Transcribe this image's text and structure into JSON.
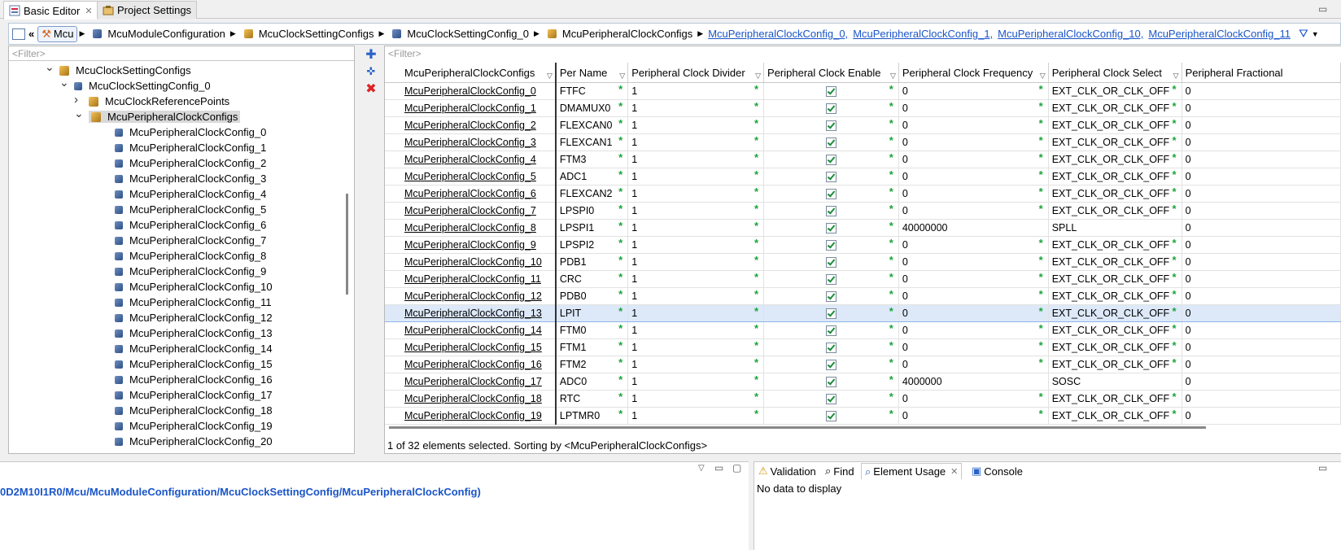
{
  "tabs": [
    {
      "label": "Basic Editor",
      "active": true
    },
    {
      "label": "Project Settings",
      "active": false
    }
  ],
  "breadcrumb": {
    "root": "Mcu",
    "items": [
      "McuModuleConfiguration",
      "McuClockSettingConfigs",
      "McuClockSettingConfig_0",
      "McuPeripheralClockConfigs"
    ],
    "links": [
      "McuPeripheralClockConfig_0,",
      "McuPeripheralClockConfig_1,",
      "McuPeripheralClockConfig_10,",
      "McuPeripheralClockConfig_11"
    ]
  },
  "tree": {
    "filter_placeholder": "<Filter>",
    "nodes": [
      {
        "label": "McuClockSettingConfigs",
        "level": 0,
        "expander": "open",
        "icon": "gold"
      },
      {
        "label": "McuClockSettingConfig_0",
        "level": 1,
        "expander": "open",
        "icon": "blue"
      },
      {
        "label": "McuClockReferencePoints",
        "level": 2,
        "expander": "closed",
        "icon": "gold"
      },
      {
        "label": "McuPeripheralClockConfigs",
        "level": 2,
        "expander": "open",
        "icon": "gold",
        "selected": true
      },
      {
        "label": "McuPeripheralClockConfig_0",
        "level": 3,
        "icon": "blue"
      },
      {
        "label": "McuPeripheralClockConfig_1",
        "level": 3,
        "icon": "blue"
      },
      {
        "label": "McuPeripheralClockConfig_2",
        "level": 3,
        "icon": "blue"
      },
      {
        "label": "McuPeripheralClockConfig_3",
        "level": 3,
        "icon": "blue"
      },
      {
        "label": "McuPeripheralClockConfig_4",
        "level": 3,
        "icon": "blue"
      },
      {
        "label": "McuPeripheralClockConfig_5",
        "level": 3,
        "icon": "blue"
      },
      {
        "label": "McuPeripheralClockConfig_6",
        "level": 3,
        "icon": "blue"
      },
      {
        "label": "McuPeripheralClockConfig_7",
        "level": 3,
        "icon": "blue"
      },
      {
        "label": "McuPeripheralClockConfig_8",
        "level": 3,
        "icon": "blue"
      },
      {
        "label": "McuPeripheralClockConfig_9",
        "level": 3,
        "icon": "blue"
      },
      {
        "label": "McuPeripheralClockConfig_10",
        "level": 3,
        "icon": "blue"
      },
      {
        "label": "McuPeripheralClockConfig_11",
        "level": 3,
        "icon": "blue"
      },
      {
        "label": "McuPeripheralClockConfig_12",
        "level": 3,
        "icon": "blue"
      },
      {
        "label": "McuPeripheralClockConfig_13",
        "level": 3,
        "icon": "blue"
      },
      {
        "label": "McuPeripheralClockConfig_14",
        "level": 3,
        "icon": "blue"
      },
      {
        "label": "McuPeripheralClockConfig_15",
        "level": 3,
        "icon": "blue"
      },
      {
        "label": "McuPeripheralClockConfig_16",
        "level": 3,
        "icon": "blue"
      },
      {
        "label": "McuPeripheralClockConfig_17",
        "level": 3,
        "icon": "blue"
      },
      {
        "label": "McuPeripheralClockConfig_18",
        "level": 3,
        "icon": "blue"
      },
      {
        "label": "McuPeripheralClockConfig_19",
        "level": 3,
        "icon": "blue"
      },
      {
        "label": "McuPeripheralClockConfig_20",
        "level": 3,
        "icon": "blue"
      }
    ]
  },
  "table": {
    "filter_placeholder": "<Filter>",
    "columns": [
      "McuPeripheralClockConfigs",
      "Per Name",
      "Peripheral Clock Divider",
      "Peripheral Clock Enable",
      "Peripheral Clock Frequency",
      "Peripheral Clock Select",
      "Peripheral Fractional"
    ],
    "rows": [
      {
        "name": "McuPeripheralClockConfig_0",
        "per": "FTFC",
        "div": "1",
        "enable": true,
        "freq": "0",
        "sel": "EXT_CLK_OR_CLK_OFF",
        "frac": "0",
        "freq_star": true,
        "sel_star": true
      },
      {
        "name": "McuPeripheralClockConfig_1",
        "per": "DMAMUX0",
        "div": "1",
        "enable": true,
        "freq": "0",
        "sel": "EXT_CLK_OR_CLK_OFF",
        "frac": "0",
        "freq_star": true,
        "sel_star": true
      },
      {
        "name": "McuPeripheralClockConfig_2",
        "per": "FLEXCAN0",
        "div": "1",
        "enable": true,
        "freq": "0",
        "sel": "EXT_CLK_OR_CLK_OFF",
        "frac": "0",
        "freq_star": true,
        "sel_star": true
      },
      {
        "name": "McuPeripheralClockConfig_3",
        "per": "FLEXCAN1",
        "div": "1",
        "enable": true,
        "freq": "0",
        "sel": "EXT_CLK_OR_CLK_OFF",
        "frac": "0",
        "freq_star": true,
        "sel_star": true
      },
      {
        "name": "McuPeripheralClockConfig_4",
        "per": "FTM3",
        "div": "1",
        "enable": true,
        "freq": "0",
        "sel": "EXT_CLK_OR_CLK_OFF",
        "frac": "0",
        "freq_star": true,
        "sel_star": true
      },
      {
        "name": "McuPeripheralClockConfig_5",
        "per": "ADC1",
        "div": "1",
        "enable": true,
        "freq": "0",
        "sel": "EXT_CLK_OR_CLK_OFF",
        "frac": "0",
        "freq_star": true,
        "sel_star": true
      },
      {
        "name": "McuPeripheralClockConfig_6",
        "per": "FLEXCAN2",
        "div": "1",
        "enable": true,
        "freq": "0",
        "sel": "EXT_CLK_OR_CLK_OFF",
        "frac": "0",
        "freq_star": true,
        "sel_star": true
      },
      {
        "name": "McuPeripheralClockConfig_7",
        "per": "LPSPI0",
        "div": "1",
        "enable": true,
        "freq": "0",
        "sel": "EXT_CLK_OR_CLK_OFF",
        "frac": "0",
        "freq_star": true,
        "sel_star": true
      },
      {
        "name": "McuPeripheralClockConfig_8",
        "per": "LPSPI1",
        "div": "1",
        "enable": true,
        "freq": "40000000",
        "sel": "SPLL",
        "frac": "0",
        "freq_star": false,
        "sel_star": false
      },
      {
        "name": "McuPeripheralClockConfig_9",
        "per": "LPSPI2",
        "div": "1",
        "enable": true,
        "freq": "0",
        "sel": "EXT_CLK_OR_CLK_OFF",
        "frac": "0",
        "freq_star": true,
        "sel_star": true
      },
      {
        "name": "McuPeripheralClockConfig_10",
        "per": "PDB1",
        "div": "1",
        "enable": true,
        "freq": "0",
        "sel": "EXT_CLK_OR_CLK_OFF",
        "frac": "0",
        "freq_star": true,
        "sel_star": true
      },
      {
        "name": "McuPeripheralClockConfig_11",
        "per": "CRC",
        "div": "1",
        "enable": true,
        "freq": "0",
        "sel": "EXT_CLK_OR_CLK_OFF",
        "frac": "0",
        "freq_star": true,
        "sel_star": true
      },
      {
        "name": "McuPeripheralClockConfig_12",
        "per": "PDB0",
        "div": "1",
        "enable": true,
        "freq": "0",
        "sel": "EXT_CLK_OR_CLK_OFF",
        "frac": "0",
        "freq_star": true,
        "sel_star": true
      },
      {
        "name": "McuPeripheralClockConfig_13",
        "per": "LPIT",
        "div": "1",
        "enable": true,
        "freq": "0",
        "sel": "EXT_CLK_OR_CLK_OFF",
        "frac": "0",
        "freq_star": true,
        "sel_star": true,
        "highlight": true
      },
      {
        "name": "McuPeripheralClockConfig_14",
        "per": "FTM0",
        "div": "1",
        "enable": true,
        "freq": "0",
        "sel": "EXT_CLK_OR_CLK_OFF",
        "frac": "0",
        "freq_star": true,
        "sel_star": true
      },
      {
        "name": "McuPeripheralClockConfig_15",
        "per": "FTM1",
        "div": "1",
        "enable": true,
        "freq": "0",
        "sel": "EXT_CLK_OR_CLK_OFF",
        "frac": "0",
        "freq_star": true,
        "sel_star": true
      },
      {
        "name": "McuPeripheralClockConfig_16",
        "per": "FTM2",
        "div": "1",
        "enable": true,
        "freq": "0",
        "sel": "EXT_CLK_OR_CLK_OFF",
        "frac": "0",
        "freq_star": true,
        "sel_star": true
      },
      {
        "name": "McuPeripheralClockConfig_17",
        "per": "ADC0",
        "div": "1",
        "enable": true,
        "freq": "4000000",
        "sel": "SOSC",
        "frac": "0",
        "freq_star": false,
        "sel_star": false
      },
      {
        "name": "McuPeripheralClockConfig_18",
        "per": "RTC",
        "div": "1",
        "enable": true,
        "freq": "0",
        "sel": "EXT_CLK_OR_CLK_OFF",
        "frac": "0",
        "freq_star": true,
        "sel_star": true
      },
      {
        "name": "McuPeripheralClockConfig_19",
        "per": "LPTMR0",
        "div": "1",
        "enable": true,
        "freq": "0",
        "sel": "EXT_CLK_OR_CLK_OFF",
        "frac": "0",
        "freq_star": true,
        "sel_star": true
      }
    ]
  },
  "status": "1 of 32 elements selected. Sorting by <McuPeripheralClockConfigs>",
  "bottom": {
    "path": "0D2M10I1R0/Mcu/McuModuleConfiguration/McuClockSettingConfig/McuPeripheralClockConfig)",
    "tabs": [
      {
        "label": "Validation"
      },
      {
        "label": "Find"
      },
      {
        "label": "Element Usage",
        "active": true
      },
      {
        "label": "Console"
      }
    ],
    "empty": "No data to display"
  }
}
